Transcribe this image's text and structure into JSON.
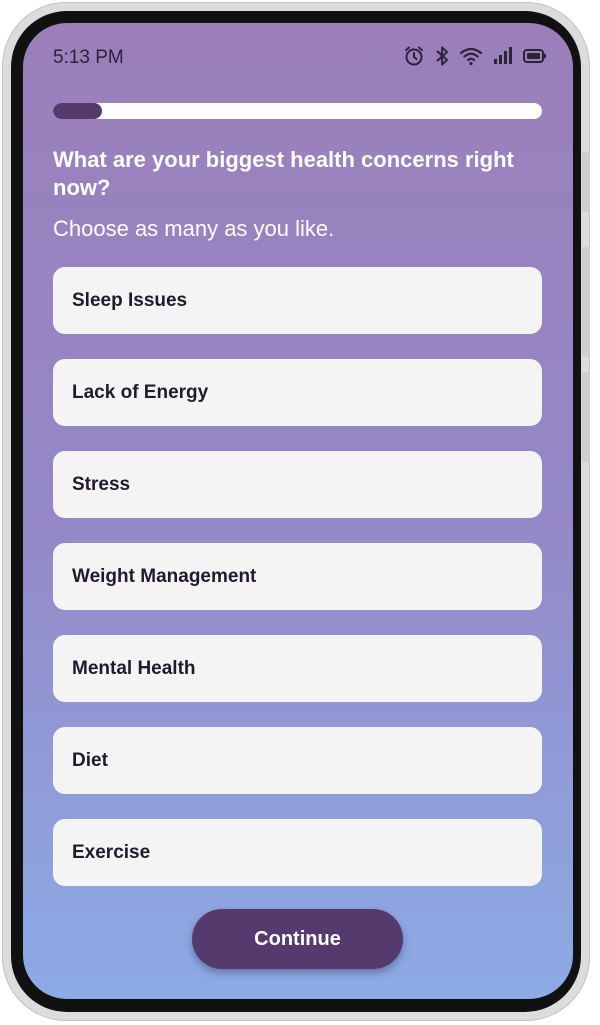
{
  "status_bar": {
    "time": "5:13 PM",
    "icons": [
      "alarm-icon",
      "bluetooth-icon",
      "wifi-icon",
      "signal-icon",
      "battery-icon"
    ]
  },
  "progress": {
    "fraction": 0.1,
    "track_color": "#ffffff",
    "fill_color": "#553a6e"
  },
  "question": {
    "title": "What are your biggest health concerns right now?",
    "subtitle": "Choose as many as you like."
  },
  "options": [
    {
      "label": "Sleep Issues"
    },
    {
      "label": "Lack of Energy"
    },
    {
      "label": "Stress"
    },
    {
      "label": "Weight Management"
    },
    {
      "label": "Mental Health"
    },
    {
      "label": "Diet"
    },
    {
      "label": "Exercise"
    }
  ],
  "continue_button": {
    "label": "Continue",
    "color": "#553a6e"
  },
  "colors": {
    "gradient_top": "#9b7fba",
    "gradient_bottom": "#8cabe6",
    "option_background": "#f5f4f4"
  }
}
